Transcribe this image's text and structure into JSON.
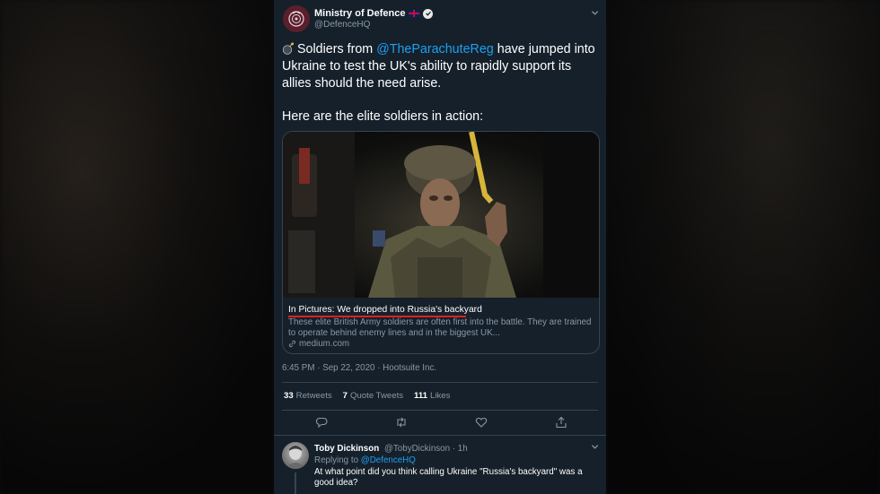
{
  "tweet": {
    "author_name": "Ministry of Defence",
    "author_handle": "@DefenceHQ",
    "text_prefix": "Soldiers from ",
    "text_mention": "@TheParachuteReg",
    "text_suffix": " have jumped into Ukraine to test the UK's ability to rapidly support its allies should the need arise.",
    "text_para2": "Here are the elite soldiers in action:",
    "timestamp": "6:45 PM · Sep 22, 2020 · Hootsuite Inc.",
    "stats": {
      "retweets_count": "33",
      "retweets_label": "Retweets",
      "quotes_count": "7",
      "quotes_label": "Quote Tweets",
      "likes_count": "111",
      "likes_label": "Likes"
    }
  },
  "card": {
    "title": "In Pictures: We dropped into Russia's backyard",
    "description": "These elite British Army soldiers are often first into the battle. They are trained to operate behind enemy lines and in the biggest UK...",
    "domain": "medium.com"
  },
  "reply": {
    "author_name": "Toby Dickinson",
    "author_handle": "@TobyDickinson",
    "time": "· 1h",
    "replying_prefix": "Replying to ",
    "replying_mention": "@DefenceHQ",
    "text": "At what point did you think calling Ukraine \"Russia's backyard\" was a good idea?"
  },
  "colors": {
    "panel_bg": "#15202b",
    "mention": "#1da1f2",
    "secondary_text": "#8899a6",
    "highlight_underline": "#e0201f"
  },
  "icons": [
    "ministry-crest-icon",
    "uk-flag-icon",
    "verified-badge-icon",
    "chevron-down-icon",
    "bomb-emoji-icon",
    "link-icon",
    "reply-icon",
    "retweet-icon",
    "like-icon",
    "share-icon"
  ]
}
